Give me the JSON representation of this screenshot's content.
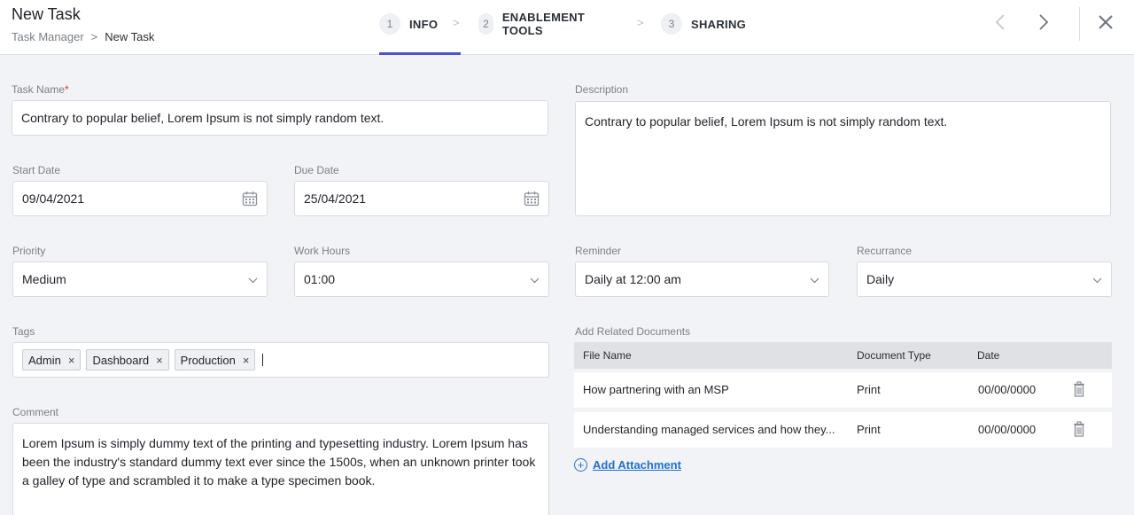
{
  "header": {
    "title": "New Task",
    "breadcrumb": {
      "root": "Task Manager",
      "separator": ">",
      "current": "New Task"
    },
    "steps": [
      {
        "num": "1",
        "label": "INFO",
        "active": true
      },
      {
        "num": "2",
        "label": "ENABLEMENT TOOLS",
        "active": false
      },
      {
        "num": "3",
        "label": "SHARING",
        "active": false
      }
    ],
    "step_separator": ">",
    "prev_icon": "‹",
    "next_icon": "›",
    "close_icon": "✕"
  },
  "form": {
    "task_name": {
      "label": "Task Name",
      "required_mark": "*",
      "value": "Contrary to popular belief, Lorem Ipsum is not simply random text."
    },
    "description": {
      "label": "Description",
      "value": "Contrary to popular belief, Lorem Ipsum is not simply random text."
    },
    "start_date": {
      "label": "Start Date",
      "value": "09/04/2021"
    },
    "due_date": {
      "label": "Due Date",
      "value": "25/04/2021"
    },
    "priority": {
      "label": "Priority",
      "value": "Medium"
    },
    "work_hours": {
      "label": "Work Hours",
      "value": "01:00"
    },
    "reminder": {
      "label": "Reminder",
      "value": "Daily at 12:00 am"
    },
    "recurrance": {
      "label": "Recurrance",
      "value": "Daily"
    },
    "tags": {
      "label": "Tags",
      "items": [
        "Admin",
        "Dashboard",
        "Production"
      ],
      "remove_glyph": "×"
    },
    "comment": {
      "label": "Comment",
      "value": "Lorem Ipsum is simply dummy text of the printing and typesetting industry. Lorem Ipsum has been the industry's standard dummy text ever since the 1500s, when an unknown printer took a galley of type and scrambled it to make a type specimen book."
    }
  },
  "documents": {
    "label": "Add Related Documents",
    "columns": [
      "File Name",
      "Document Type",
      "Date"
    ],
    "rows": [
      {
        "file": "How partnering with an MSP",
        "type": "Print",
        "date": "00/00/0000"
      },
      {
        "file": "Understanding managed services and how they...",
        "type": "Print",
        "date": "00/00/0000"
      }
    ],
    "add_attachment": "Add Attachment"
  },
  "colors": {
    "accent": "#4b53d1",
    "link": "#1f6fd1",
    "required": "#d9363e"
  }
}
